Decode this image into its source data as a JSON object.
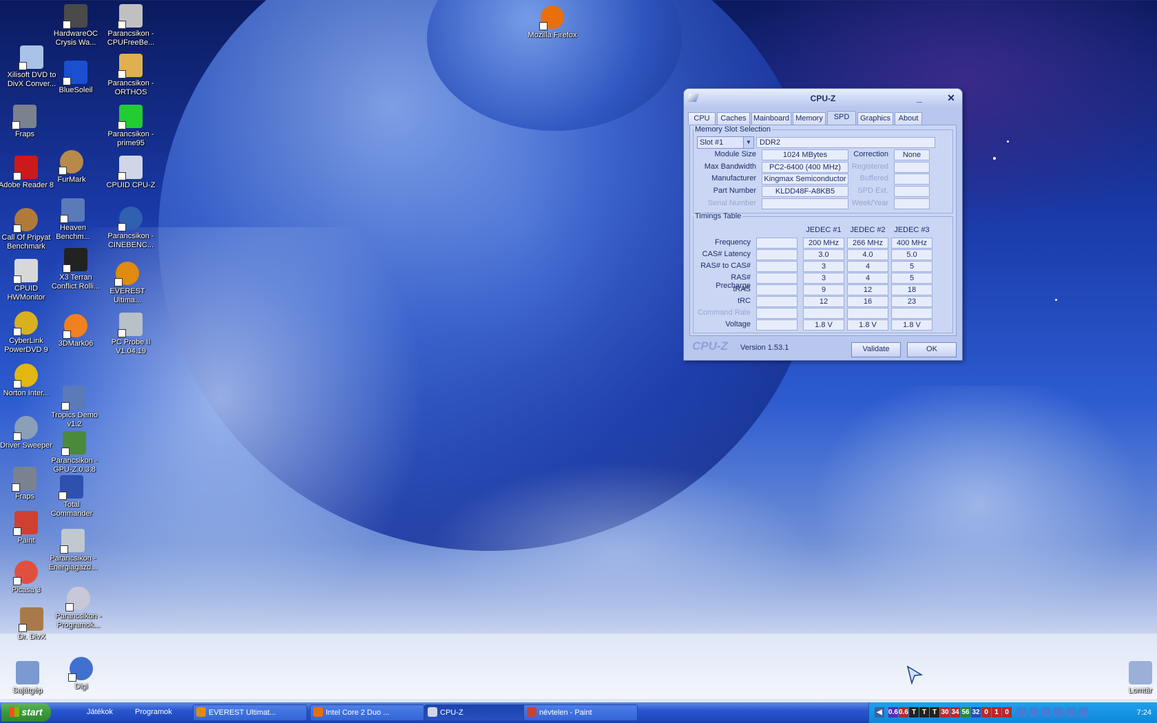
{
  "desktop": {
    "icons": [
      {
        "label": "HardwareOC Crysis Wa...",
        "icon": "crysis-icon",
        "color": "#4a4a4a"
      },
      {
        "label": "Parancsikon - CPUFreeBe...",
        "icon": "cpufree-icon",
        "color": "#c0c0c0"
      },
      {
        "label": "Mozilla Firefox",
        "icon": "firefox-icon",
        "color": "#e8700c"
      },
      {
        "label": "Xilisoft DVD to DivX Conver...",
        "icon": "xilisoft-icon",
        "color": "#a8c2e8"
      },
      {
        "label": "BlueSoleil",
        "icon": "bluetooth-icon",
        "color": "#1a4fd0"
      },
      {
        "label": "Parancsikon - ORTHOS",
        "icon": "orthos-icon",
        "color": "#e0b050"
      },
      {
        "label": "Fraps",
        "icon": "fraps-icon",
        "color": "#7a8290"
      },
      {
        "label": "Parancsikon - prime95",
        "icon": "prime95-icon",
        "color": "#22cc33"
      },
      {
        "label": "FurMark",
        "icon": "furmark-icon",
        "color": "#b88a4a"
      },
      {
        "label": "Adobe Reader 8",
        "icon": "adobe-reader-icon",
        "color": "#cc1a1a"
      },
      {
        "label": "CPUID CPU-Z",
        "icon": "cpuz-icon",
        "color": "#d0d6e8"
      },
      {
        "label": "Heaven Benchm...",
        "icon": "heaven-icon",
        "color": "#5a7ab8"
      },
      {
        "label": "Call Of Pripyat Benchmark",
        "icon": "pripyat-icon",
        "color": "#b07a3a"
      },
      {
        "label": "Parancsikon - CINEBENC...",
        "icon": "cinebench-icon",
        "color": "#3060b0"
      },
      {
        "label": "X3 Terran Conflict Rolli...",
        "icon": "x3-icon",
        "color": "#222222"
      },
      {
        "label": "CPUID HWMonitor",
        "icon": "hwmonitor-icon",
        "color": "#d8d8d8"
      },
      {
        "label": "EVEREST Ultima...",
        "icon": "everest-icon",
        "color": "#e08a10"
      },
      {
        "label": "CyberLink PowerDVD 9",
        "icon": "powerdvd-icon",
        "color": "#d8b020"
      },
      {
        "label": "3DMark06",
        "icon": "3dmark-icon",
        "color": "#f08020"
      },
      {
        "label": "PC Probe II V1.04.19",
        "icon": "pcprobe-icon",
        "color": "#b8c0c8"
      },
      {
        "label": "Norton Inter...",
        "icon": "norton-icon",
        "color": "#e0b810"
      },
      {
        "label": "Tropics Demo v1.2",
        "icon": "tropics-icon",
        "color": "#5a7ab8"
      },
      {
        "label": "Driver Sweeper",
        "icon": "driver-sweeper-icon",
        "color": "#8aa0b8"
      },
      {
        "label": "Parancsikon - GPU-Z.0.3.8",
        "icon": "gpuz-icon",
        "color": "#4a8a3a"
      },
      {
        "label": "Fraps",
        "icon": "fraps-icon",
        "color": "#7a8290"
      },
      {
        "label": "Total Commander",
        "icon": "total-commander-icon",
        "color": "#3050b0"
      },
      {
        "label": "Paint",
        "icon": "paint-icon",
        "color": "#d04030"
      },
      {
        "label": "Parancsikon - Energiagazd...",
        "icon": "energy-icon",
        "color": "#c0c8d0"
      },
      {
        "label": "Picasa 3",
        "icon": "picasa-icon",
        "color": "#e05040"
      },
      {
        "label": "Parancsikon - Programok...",
        "icon": "programs-icon",
        "color": "#c8c8d8"
      },
      {
        "label": "Dr. DivX",
        "icon": "drdivx-icon",
        "color": "#a87a4a"
      },
      {
        "label": "Sajátgép",
        "icon": "my-computer-icon",
        "color": "#7a9ad0"
      },
      {
        "label": "Digi",
        "icon": "digi-icon",
        "color": "#4070d0"
      },
      {
        "label": "Lomtár",
        "icon": "recycle-bin-icon",
        "color": "#9ab0d8"
      }
    ]
  },
  "cpuz": {
    "title": "CPU-Z",
    "minimize": "_",
    "close": "✕",
    "tabs": [
      "CPU",
      "Caches",
      "Mainboard",
      "Memory",
      "SPD",
      "Graphics",
      "About"
    ],
    "active_tab": "SPD",
    "slot_group_label": "Memory Slot Selection",
    "slot_value": "Slot #1",
    "memory_type": "DDR2",
    "module_size_label": "Module Size",
    "module_size": "1024 MBytes",
    "max_bandwidth_label": "Max Bandwidth",
    "max_bandwidth": "PC2-6400 (400 MHz)",
    "manufacturer_label": "Manufacturer",
    "manufacturer": "Kingmax Semiconductor",
    "part_number_label": "Part Number",
    "part_number": "KLDD48F-A8KB5",
    "serial_number_label": "Serial Number",
    "serial_number": "",
    "correction_label": "Correction",
    "correction": "None",
    "registered_label": "Registered",
    "buffered_label": "Buffered",
    "spd_ext_label": "SPD Ext.",
    "week_year_label": "Week/Year",
    "timings_group_label": "Timings Table",
    "timing_columns": [
      "JEDEC #1",
      "JEDEC #2",
      "JEDEC #3"
    ],
    "timing_rows": [
      {
        "label": "Frequency",
        "values": [
          "200 MHz",
          "266 MHz",
          "400 MHz"
        ],
        "dim": false
      },
      {
        "label": "CAS# Latency",
        "values": [
          "3.0",
          "4.0",
          "5.0"
        ],
        "dim": false
      },
      {
        "label": "RAS# to CAS#",
        "values": [
          "3",
          "4",
          "5"
        ],
        "dim": false
      },
      {
        "label": "RAS# Precharge",
        "values": [
          "3",
          "4",
          "5"
        ],
        "dim": false
      },
      {
        "label": "tRAS",
        "values": [
          "9",
          "12",
          "18"
        ],
        "dim": false
      },
      {
        "label": "tRC",
        "values": [
          "12",
          "16",
          "23"
        ],
        "dim": false
      },
      {
        "label": "Command Rate",
        "values": [
          "",
          "",
          ""
        ],
        "dim": true
      },
      {
        "label": "Voltage",
        "values": [
          "1.8 V",
          "1.8 V",
          "1.8 V"
        ],
        "dim": false
      }
    ],
    "brand": "CPU-Z",
    "version": "Version 1.53.1",
    "validate_label": "Validate",
    "ok_label": "OK"
  },
  "taskbar": {
    "start_label": "start",
    "quick_launch": [
      "Játékok",
      "Programok"
    ],
    "buttons": [
      {
        "label": "EVEREST Ultimat...",
        "icon": "everest-icon",
        "color": "#e08a10",
        "active": false
      },
      {
        "label": "Intel Core 2 Duo ...",
        "icon": "firefox-icon",
        "color": "#e8700c",
        "active": false
      },
      {
        "label": "CPU-Z",
        "icon": "cpuz-icon",
        "color": "#d0d6e8",
        "active": true
      },
      {
        "label": "névtelen - Paint",
        "icon": "paint-icon",
        "color": "#d04030",
        "active": false
      }
    ],
    "tray_values": [
      "0.6",
      "0.6",
      "T",
      "T",
      "T",
      "30",
      "34",
      "56",
      "32",
      "0",
      "1",
      "0"
    ],
    "clock": "7:24"
  }
}
